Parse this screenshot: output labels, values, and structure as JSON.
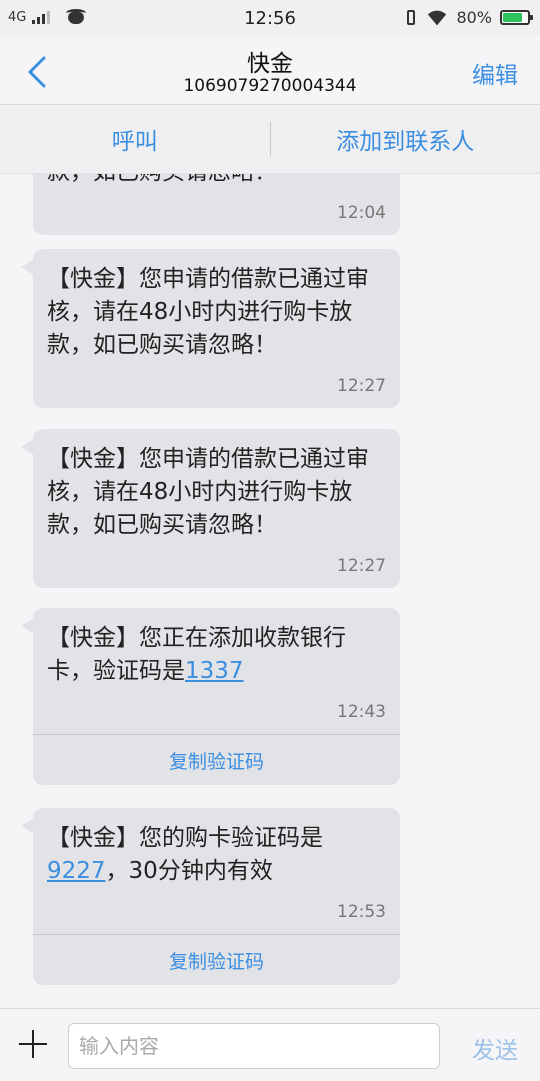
{
  "status_bar": {
    "network": "4G",
    "time": "12:56",
    "battery_percent_label": "80%",
    "battery_level": 0.8
  },
  "header": {
    "title": "快金",
    "number": "1069079270004344",
    "edit_label": "编辑"
  },
  "actions": {
    "call_label": "呼叫",
    "add_contact_label": "添加到联系人"
  },
  "messages": [
    {
      "text": "款，如已购买请忽略！",
      "time": "12:04"
    },
    {
      "text": "【快金】您申请的借款已通过审核，请在48小时内进行购卡放款，如已购买请忽略！",
      "time": "12:27"
    },
    {
      "text": "【快金】您申请的借款已通过审核，请在48小时内进行购卡放款，如已购买请忽略！",
      "time": "12:27"
    },
    {
      "text_before": "【快金】您正在添加收款银行卡，验证码是",
      "code": "1337",
      "text_after": "",
      "time": "12:43",
      "copy_label": "复制验证码"
    },
    {
      "text_before": "【快金】您的购卡验证码是",
      "code": "9227",
      "text_after": "，30分钟内有效",
      "time": "12:53",
      "copy_label": "复制验证码"
    }
  ],
  "input": {
    "placeholder": "输入内容",
    "value": "",
    "send_label": "发送"
  },
  "colors": {
    "accent": "#3b8ee0",
    "bubble": "#e2e3e7",
    "send_disabled": "#9cc2ea",
    "battery": "#2fc45b"
  }
}
